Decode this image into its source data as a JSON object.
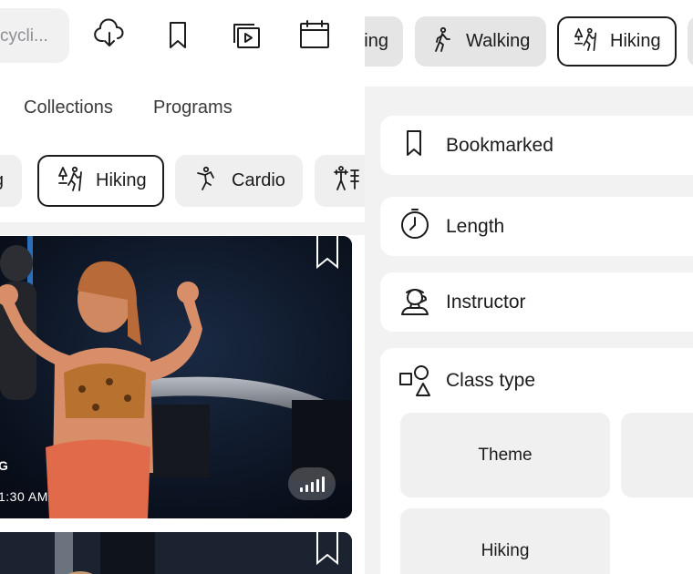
{
  "left": {
    "search_placeholder": "cycli...",
    "nav_tabs": [
      "Collections",
      "Programs"
    ],
    "chips": [
      {
        "label": "g",
        "icon": "walking-icon"
      },
      {
        "label": "Hiking",
        "icon": "hiking-icon",
        "selected": true
      },
      {
        "label": "Cardio",
        "icon": "cardio-icon"
      },
      {
        "label": "",
        "icon": "strength-icon"
      }
    ],
    "card": {
      "title_fragment": "G",
      "time_fragment": "1:30 AM",
      "difficulty_icon": "difficulty-bars-icon"
    }
  },
  "right": {
    "chips": [
      {
        "label": "ing",
        "icon": ""
      },
      {
        "label": "Walking",
        "icon": "walking-icon"
      },
      {
        "label": "Hiking",
        "icon": "hiking-icon",
        "selected": true
      }
    ],
    "filters": [
      {
        "label": "Bookmarked",
        "icon": "bookmark-icon"
      },
      {
        "label": "Length",
        "icon": "clock-icon"
      },
      {
        "label": "Instructor",
        "icon": "instructor-icon"
      },
      {
        "label": "Class type",
        "icon": "shapes-icon"
      }
    ],
    "class_type_options": [
      "Theme",
      "",
      "Hiking"
    ]
  }
}
